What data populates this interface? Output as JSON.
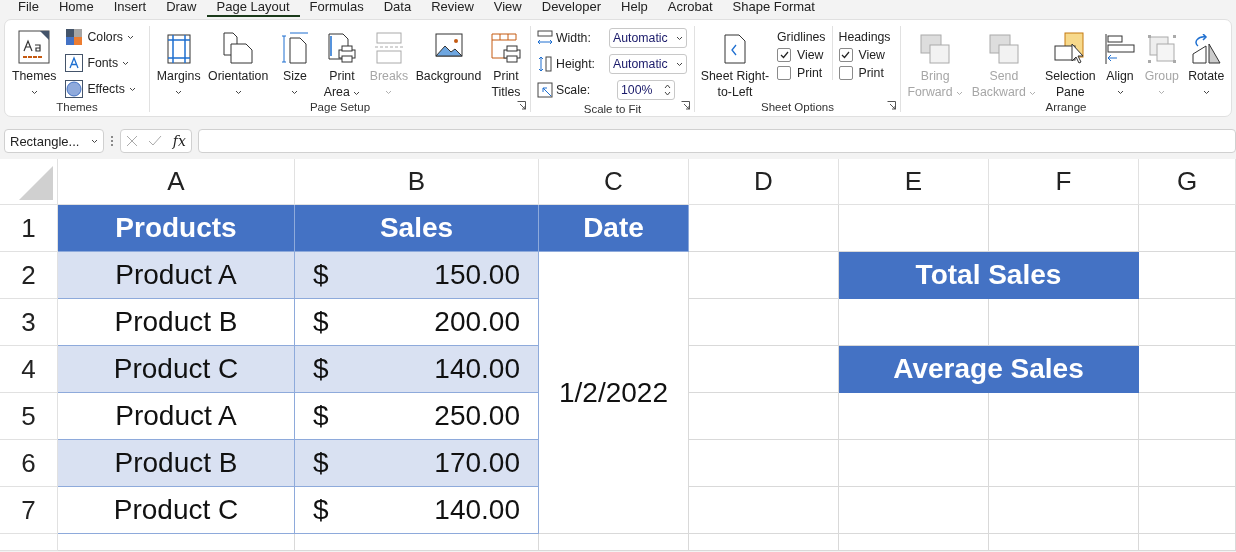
{
  "menu_tabs": [
    {
      "label": "File",
      "selected": false
    },
    {
      "label": "Home",
      "selected": false
    },
    {
      "label": "Insert",
      "selected": false
    },
    {
      "label": "Draw",
      "selected": false
    },
    {
      "label": "Page Layout",
      "selected": true
    },
    {
      "label": "Formulas",
      "selected": false
    },
    {
      "label": "Data",
      "selected": false
    },
    {
      "label": "Review",
      "selected": false
    },
    {
      "label": "View",
      "selected": false
    },
    {
      "label": "Developer",
      "selected": false
    },
    {
      "label": "Help",
      "selected": false
    },
    {
      "label": "Acrobat",
      "selected": false
    },
    {
      "label": "Shape Format",
      "selected": false
    }
  ],
  "ribbon": {
    "themes": {
      "label": "Themes",
      "button": {
        "label": "Themes",
        "dropdown": true
      },
      "small": [
        {
          "label": "Colors",
          "dropdown": true
        },
        {
          "label": "Fonts",
          "dropdown": true
        },
        {
          "label": "Effects",
          "dropdown": true
        }
      ]
    },
    "page_setup": {
      "label": "Page Setup",
      "buttons": [
        {
          "label": "Margins",
          "dropdown": true,
          "disabled": false
        },
        {
          "label": "Orientation",
          "dropdown": true,
          "disabled": false
        },
        {
          "label": "Size",
          "dropdown": true,
          "disabled": false
        },
        {
          "label": "Print\nArea",
          "dropdown": true,
          "disabled": false
        },
        {
          "label": "Breaks",
          "dropdown": true,
          "disabled": true
        },
        {
          "label": "Background",
          "dropdown": false,
          "disabled": false
        },
        {
          "label": "Print\nTitles",
          "dropdown": false,
          "disabled": false
        }
      ]
    },
    "scale_to_fit": {
      "label": "Scale to Fit",
      "rows": [
        {
          "label": "Width:",
          "value": "Automatic",
          "kind": "dropdown"
        },
        {
          "label": "Height:",
          "value": "Automatic",
          "kind": "dropdown"
        },
        {
          "label": "Scale:",
          "value": "100%",
          "kind": "spinner"
        }
      ]
    },
    "sheet_options": {
      "label": "Sheet Options",
      "button": {
        "label": "Sheet Right-\nto-Left"
      },
      "columns": [
        {
          "title": "Gridlines",
          "options": [
            {
              "label": "View",
              "checked": true
            },
            {
              "label": "Print",
              "checked": false
            }
          ]
        },
        {
          "title": "Headings",
          "options": [
            {
              "label": "View",
              "checked": true
            },
            {
              "label": "Print",
              "checked": false
            }
          ]
        }
      ]
    },
    "arrange": {
      "label": "Arrange",
      "buttons": [
        {
          "label": "Bring\nForward",
          "dropdown": true,
          "disabled": true
        },
        {
          "label": "Send\nBackward",
          "dropdown": true,
          "disabled": true
        },
        {
          "label": "Selection\nPane",
          "dropdown": false,
          "disabled": false
        },
        {
          "label": "Align",
          "dropdown": true,
          "disabled": false
        },
        {
          "label": "Group",
          "dropdown": true,
          "disabled": true
        },
        {
          "label": "Rotate",
          "dropdown": true,
          "disabled": false
        }
      ]
    }
  },
  "formula_bar": {
    "name_box": "Rectangle...",
    "fx": "fx"
  },
  "sheet": {
    "columns": [
      "A",
      "B",
      "C",
      "D",
      "E",
      "F",
      "G"
    ],
    "row_labels": [
      "1",
      "2",
      "3",
      "4",
      "5",
      "6",
      "7"
    ],
    "headers": [
      "Products",
      "Sales",
      "Date"
    ],
    "rows": [
      {
        "product": "Product A",
        "currency": "$",
        "amount": "150.00",
        "banded": true
      },
      {
        "product": "Product B",
        "currency": "$",
        "amount": "200.00",
        "banded": false
      },
      {
        "product": "Product C",
        "currency": "$",
        "amount": "140.00",
        "banded": true
      },
      {
        "product": "Product A",
        "currency": "$",
        "amount": "250.00",
        "banded": false
      },
      {
        "product": "Product B",
        "currency": "$",
        "amount": "170.00",
        "banded": true
      },
      {
        "product": "Product C",
        "currency": "$",
        "amount": "140.00",
        "banded": false
      }
    ],
    "date": "1/2/2022",
    "summary": [
      "Total Sales",
      "Average Sales"
    ]
  }
}
